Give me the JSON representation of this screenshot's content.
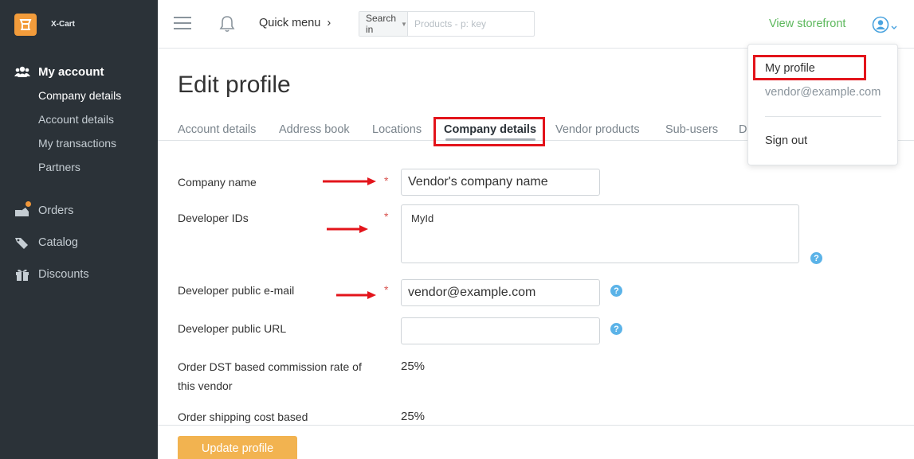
{
  "brand": {
    "name": "X-Cart"
  },
  "sidebar": {
    "section_title": "My account",
    "sub_items": [
      {
        "label": "Company details"
      },
      {
        "label": "Account details"
      },
      {
        "label": "My transactions"
      },
      {
        "label": "Partners"
      }
    ],
    "items": [
      {
        "label": "Orders",
        "icon": "orders-icon",
        "badge_color": "#f0973a"
      },
      {
        "label": "Catalog",
        "icon": "tag-icon"
      },
      {
        "label": "Discounts",
        "icon": "gift-icon"
      }
    ]
  },
  "topbar": {
    "quick_menu_label": "Quick menu",
    "search_in_label": "Search in",
    "search_placeholder": "Products - p: key",
    "view_storefront_label": "View storefront"
  },
  "user_menu": {
    "my_profile": "My profile",
    "email": "vendor@example.com",
    "sign_out": "Sign out"
  },
  "page": {
    "title": "Edit profile",
    "tabs": [
      {
        "label": "Account details"
      },
      {
        "label": "Address book"
      },
      {
        "label": "Locations"
      },
      {
        "label": "Company details"
      },
      {
        "label": "Vendor products"
      },
      {
        "label": "Sub-users"
      },
      {
        "label": "D"
      }
    ]
  },
  "form": {
    "company_name_label": "Company name",
    "company_name_value": "Vendor's company name",
    "developer_ids_label": "Developer IDs",
    "developer_ids_value": "MyId",
    "developer_email_label": "Developer public e-mail",
    "developer_email_value": "vendor@example.com",
    "developer_url_label": "Developer public URL",
    "developer_url_value": "",
    "commission_label_line1": "Order DST based commission rate of",
    "commission_label_line2": "this vendor",
    "commission_value": "25%",
    "shipping_label": "Order shipping cost based",
    "shipping_value": "25%",
    "required_mark": "*",
    "help_mark": "?"
  },
  "footer": {
    "update_button": "Update profile"
  },
  "colors": {
    "sidebar_bg": "#2b3238",
    "accent_green": "#5cb85c",
    "button_orange": "#f2b350",
    "highlight_red": "#e3141b",
    "help_blue": "#5bb3e8"
  }
}
